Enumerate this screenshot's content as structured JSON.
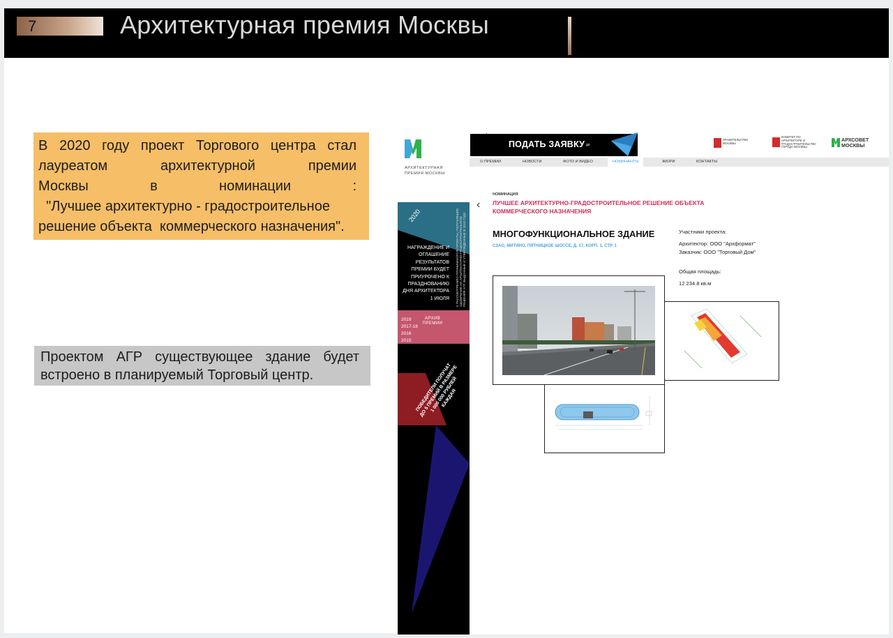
{
  "slide": {
    "page_number": "7",
    "title": "Архитектурная премия Москвы"
  },
  "note_award": {
    "lines": [
      " В 2020 году проект Торгового центра стал",
      "лауреатом архитектурной премии",
      "Москвы в номинации :",
      "  \"Лучшее архитектурно - градостроительное",
      "решение объекта  коммерческого назначения\"."
    ]
  },
  "note_agr": {
    "lines": [
      "Проектом АГР существующее здание будет",
      "встроено в планируемый Торговый центр."
    ]
  },
  "site": {
    "logo_text": "АРХИТЕКТУРНАЯ ПРЕМИЯ МОСКВЫ",
    "year": "2020",
    "award_text": "НАГРАЖДЕНИЕ И ОГЛАШЕНИЕ РЕЗУЛЬТАТОВ ПРЕМИИ БУДЕТ ПРИУРОЧЕНО К ПРАЗДНОВАНИЮ ДНЯ АРХИТЕКТОРА 1 ИЮЛЯ",
    "vertical_text": "К РАССМОТРЕНИЮ ПРИНИМАЮТСЯ ПРОЕКТЫ, ПОЛУЧИВШИЕ ОДОБРЕНИЕ НА АРХИТЕКТУРНО-ГРАДОСТРОИТЕЛЬНОМ РЕШЕНИЯ АГР, ВЫДАННЫЕ И УТВЕРЖДЕННЫЕ В 2019 ГОДУ",
    "archive_years": [
      "2019",
      "2017-18",
      "2016",
      "2015"
    ],
    "archive_label": "АРХИВ ПРЕМИИ",
    "winners_text": "ПОБЕДИТЕЛИ ПОЛУЧАТ ДО 5 ПРЕМИЙ В РАЗМЕРЕ 1 000 000 РУБЛЕЙ КАЖДАЯ",
    "cta_label": "ПОДАТЬ ЗАЯВКУ",
    "cta_small": "до",
    "partners": [
      "ПРАВИТЕЛЬСТВО МОСКВЫ",
      "КОМИТЕТ ПО АРХИТЕКТУРЕ И ГРАДОСТРОИТЕЛЬСТВУ ГОРОДА МОСКВЫ"
    ],
    "archsovet_logo": "АРХСОВЕТ МОСКВЫ",
    "nav": [
      "О ПРЕМИИ",
      "НОВОСТИ",
      "ФОТО И ВИДЕО",
      "НОМИНАНТЫ",
      "ЖЮРИ",
      "КОНТАКТЫ"
    ],
    "nav_active": "НОМИНАНТЫ",
    "back_icon": "chevron-left-icon",
    "nomination_label": "НОМИНАЦИЯ",
    "nomination_title": "ЛУЧШЕЕ АРХИТЕКТУРНО-ГРАДОСТРОИТЕЛЬНОЕ РЕШЕНИЕ ОБЪЕКТА КОММЕРЧЕСКОГО НАЗНАЧЕНИЯ",
    "building_title": "МНОГОФУНКЦИОНАЛЬНОЕ ЗДАНИЕ",
    "building_address": "СЗАО, МИТИНО, ПЯТНИЦКОЕ ШОССЕ, Д. 17, КОРП. 1, СТР. 1",
    "participants_label": "Участники проекта:",
    "architect": "Архитектор: ООО \"Архформат\"",
    "client": "Заказчик: ООО \"Торговый Дом\"",
    "area_label": "Общая площадь:",
    "area_value": "12 234.8 кв.м"
  },
  "colors": {
    "header_bg": "#000000",
    "note_award_bg": "#f6be67",
    "note_agr_bg": "#c7c7c7",
    "accent_pink": "#d12e55",
    "accent_blue": "#47a4dd"
  }
}
